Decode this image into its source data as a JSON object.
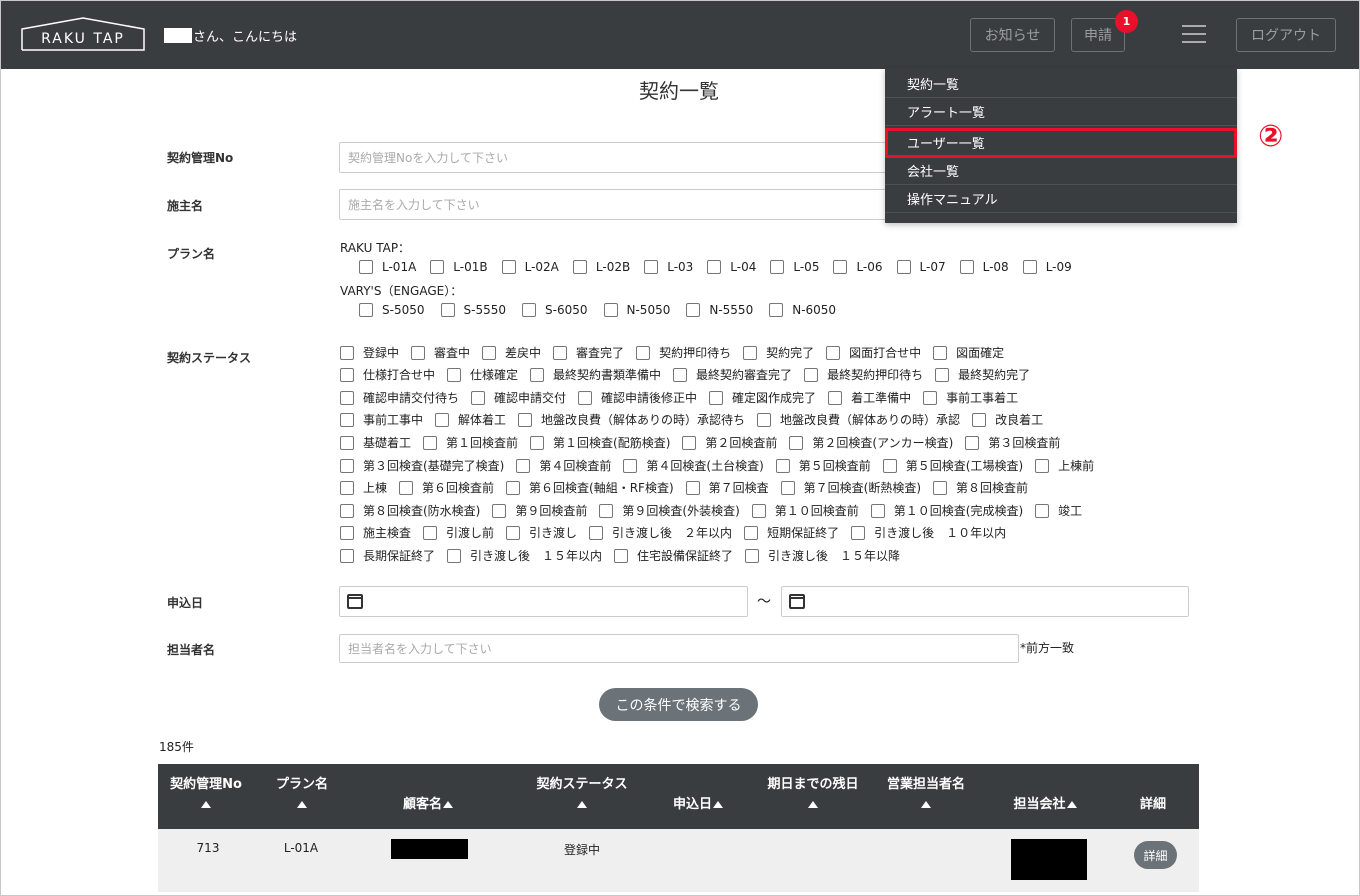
{
  "header": {
    "logo_text": "RAKU TAP",
    "greeting": "さん、こんにちは",
    "news_label": "お知らせ",
    "apply_label": "申請",
    "apply_badge": "1",
    "logout_label": "ログアウト"
  },
  "menu": {
    "items": [
      "契約一覧",
      "アラート一覧",
      "ユーザー一覧",
      "会社一覧",
      "操作マニュアル"
    ],
    "highlight_color": "#e8102a",
    "step_marker": "②"
  },
  "page_title": "契約一覧",
  "form": {
    "contract_no": {
      "label": "契約管理No",
      "placeholder": "契約管理Noを入力して下さい"
    },
    "owner": {
      "label": "施主名",
      "placeholder": "施主名を入力して下さい"
    },
    "plan": {
      "label": "プラン名",
      "group1_title": "RAKU TAP：",
      "group1_options": [
        "L-01A",
        "L-01B",
        "L-02A",
        "L-02B",
        "L-03",
        "L-04",
        "L-05",
        "L-06",
        "L-07",
        "L-08",
        "L-09"
      ],
      "group2_title": "VARY'S（ENGAGE）：",
      "group2_options": [
        "S-5050",
        "S-5550",
        "S-6050",
        "N-5050",
        "N-5550",
        "N-6050"
      ]
    },
    "status": {
      "label": "契約ステータス",
      "rows": [
        [
          "登録中",
          "審査中",
          "差戻中",
          "審査完了",
          "契約押印待ち",
          "契約完了",
          "図面打合せ中",
          "図面確定"
        ],
        [
          "仕様打合せ中",
          "仕様確定",
          "最終契約書類準備中",
          "最終契約審査完了",
          "最終契約押印待ち",
          "最終契約完了"
        ],
        [
          "確認申請交付待ち",
          "確認申請交付",
          "確認申請後修正中",
          "確定図作成完了",
          "着工準備中",
          "事前工事着工"
        ],
        [
          "事前工事中",
          "解体着工",
          "地盤改良費（解体ありの時）承認待ち",
          "地盤改良費（解体ありの時）承認",
          "改良着工"
        ],
        [
          "基礎着工",
          "第１回検査前",
          "第１回検査(配筋検査)",
          "第２回検査前",
          "第２回検査(アンカー検査)",
          "第３回検査前"
        ],
        [
          "第３回検査(基礎完了検査)",
          "第４回検査前",
          "第４回検査(土台検査)",
          "第５回検査前",
          "第５回検査(工場検査)",
          "上棟前"
        ],
        [
          "上棟",
          "第６回検査前",
          "第６回検査(軸組・RF検査)",
          "第７回検査",
          "第７回検査(断熱検査)",
          "第８回検査前"
        ],
        [
          "第８回検査(防水検査)",
          "第９回検査前",
          "第９回検査(外装検査)",
          "第１０回検査前",
          "第１０回検査(完成検査)",
          "竣工"
        ],
        [
          "施主検査",
          "引渡し前",
          "引き渡し",
          "引き渡し後　２年以内",
          "短期保証終了",
          "引き渡し後　１０年以内"
        ],
        [
          "長期保証終了",
          "引き渡し後　１５年以内",
          "住宅設備保証終了",
          "引き渡し後　１５年以降"
        ]
      ]
    },
    "apply_date": {
      "label": "申込日",
      "separator": "～"
    },
    "staff": {
      "label": "担当者名",
      "placeholder": "担当者名を入力して下さい",
      "note": "*前方一致"
    },
    "search_label": "この条件で検索する"
  },
  "result_count": "185件",
  "table": {
    "headers": [
      "契約管理No",
      "プラン名",
      "顧客名",
      "契約ステータス",
      "申込日",
      "期日までの残日",
      "営業担当者名",
      "担当会社",
      "詳細"
    ],
    "rows": [
      {
        "contract_no": "713",
        "plan": "L-01A",
        "status": "登録中",
        "detail_label": "詳細"
      }
    ]
  }
}
